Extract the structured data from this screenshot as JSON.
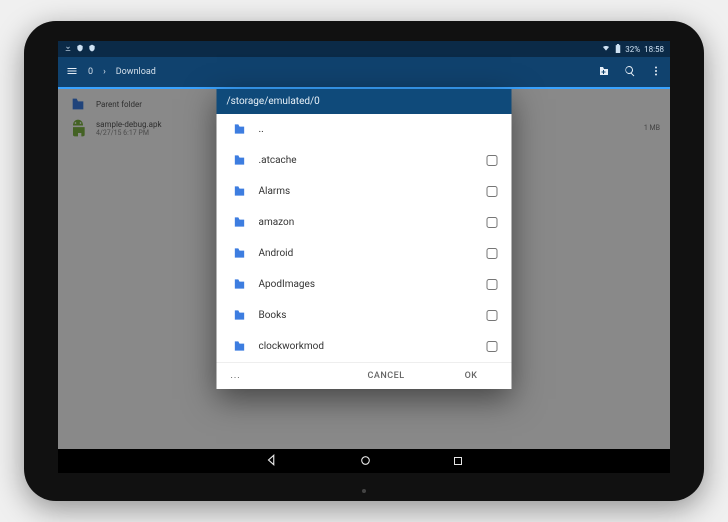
{
  "status_bar": {
    "left_icons": [
      "download-icon",
      "shield-icon",
      "shield-icon"
    ],
    "wifi_label": "",
    "battery_pct": "32%",
    "clock": "18:58"
  },
  "app_bar": {
    "menu_icon": "menu",
    "path_root": "0",
    "path_current": "Download",
    "action_create": "+",
    "action_search": "search",
    "action_more": "more"
  },
  "background": {
    "parent_label": "Parent folder",
    "file_name": "sample-debug.apk",
    "file_date": "4/27/15 6:17 PM",
    "file_size": "1 MB"
  },
  "dialog": {
    "title_path": "/storage/emulated/0",
    "items": [
      "..",
      ".atcache",
      "Alarms",
      "amazon",
      "Android",
      "ApodImages",
      "Books",
      "clockworkmod"
    ],
    "cancel_label": "CANCEL",
    "ok_label": "OK",
    "more_label": "..."
  },
  "nav": {
    "back": "back",
    "home": "home",
    "recents": "recents"
  }
}
